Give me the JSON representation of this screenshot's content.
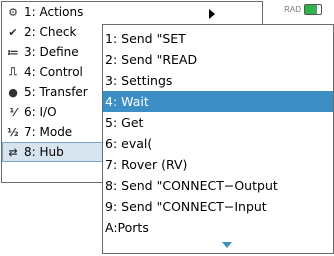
{
  "status": {
    "label": "RAD"
  },
  "main_menu": {
    "items": [
      {
        "icon": "tools-icon",
        "glyph": "⚙",
        "label": "1: Actions"
      },
      {
        "icon": "check-icon",
        "glyph": "✔",
        "label": "2: Check"
      },
      {
        "icon": "define-icon",
        "glyph": "≔",
        "label": "3: Define"
      },
      {
        "icon": "control-icon",
        "glyph": "⎍",
        "label": "4: Control"
      },
      {
        "icon": "transfer-icon",
        "glyph": "●",
        "label": "5: Transfer"
      },
      {
        "icon": "io-icon",
        "glyph": "⅟",
        "label": "6: I/O"
      },
      {
        "icon": "mode-icon",
        "glyph": "½",
        "label": "7: Mode"
      },
      {
        "icon": "hub-icon",
        "glyph": "⇄",
        "label": "8: Hub"
      }
    ]
  },
  "sub_menu": {
    "items": [
      {
        "label": "1: Send \"SET"
      },
      {
        "label": "2: Send \"READ"
      },
      {
        "label": "3: Settings"
      },
      {
        "label": "4: Wait"
      },
      {
        "label": "5: Get"
      },
      {
        "label": "6: eval("
      },
      {
        "label": "7: Rover (RV)"
      },
      {
        "label": "8: Send \"CONNECT−Output"
      },
      {
        "label": "9: Send \"CONNECT−Input"
      },
      {
        "label": "A:Ports"
      }
    ]
  },
  "colors": {
    "highlight": "#3c8fc4",
    "selected_bg": "#d6e4f0"
  }
}
